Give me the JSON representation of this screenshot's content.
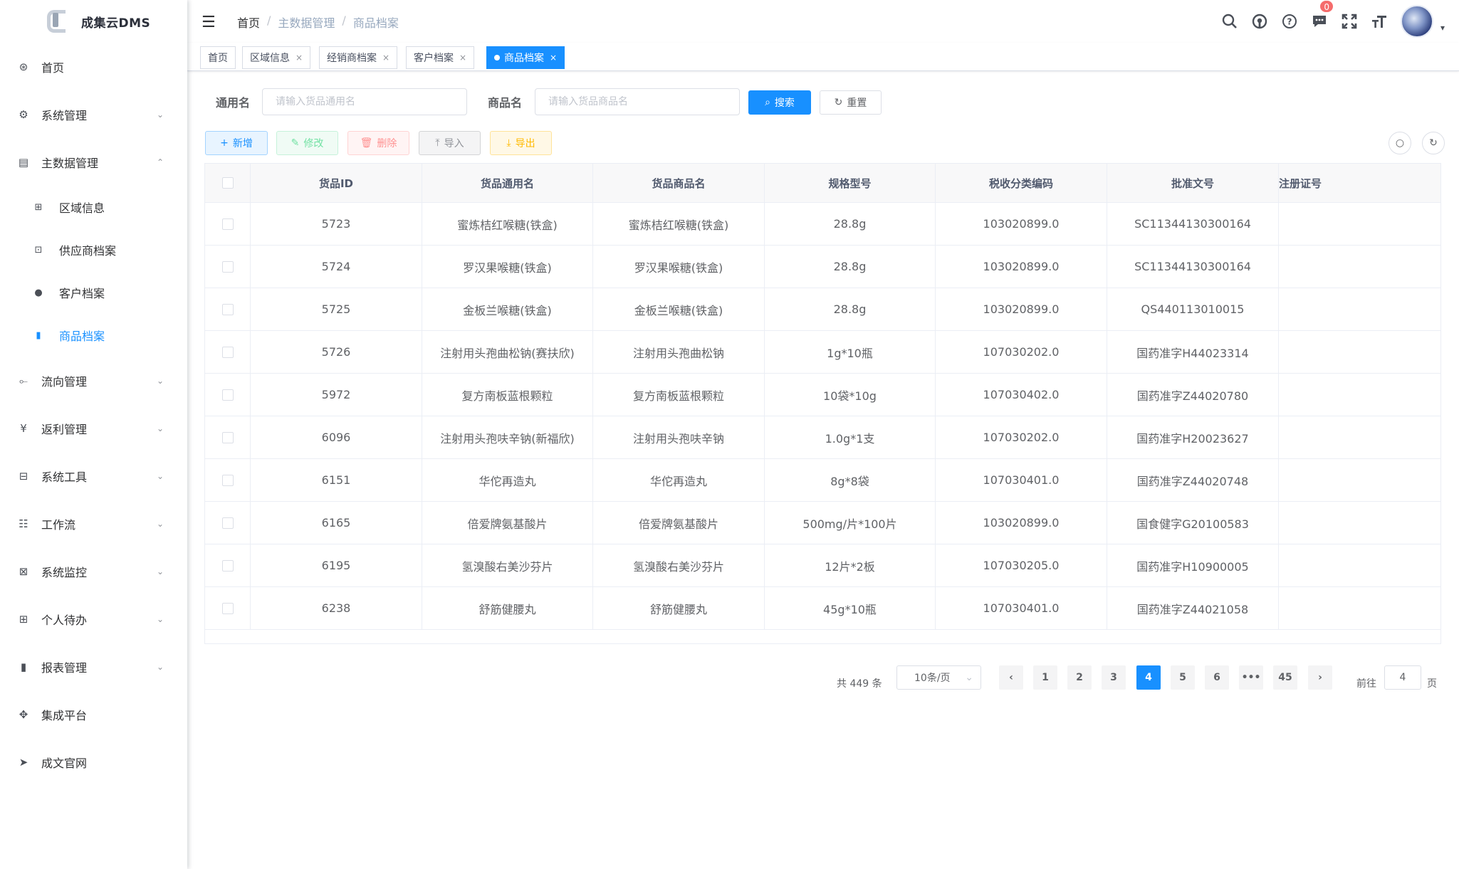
{
  "app": {
    "title": "成集云DMS"
  },
  "sidebar": {
    "items": [
      {
        "label": "首页",
        "icon": "dashboard-icon",
        "glyph": "⊛",
        "arrow": ""
      },
      {
        "label": "系统管理",
        "icon": "gear-icon",
        "glyph": "⚙",
        "arrow": "⌄"
      },
      {
        "label": "主数据管理",
        "icon": "list-icon",
        "glyph": "▤",
        "arrow": "⌃"
      },
      {
        "label": "流向管理",
        "icon": "flow-icon",
        "glyph": "⟜",
        "arrow": "⌄"
      },
      {
        "label": "返利管理",
        "icon": "yen-icon",
        "glyph": "¥",
        "arrow": "⌄"
      },
      {
        "label": "系统工具",
        "icon": "toolbox-icon",
        "glyph": "⊟",
        "arrow": "⌄"
      },
      {
        "label": "工作流",
        "icon": "workflow-icon",
        "glyph": "☷",
        "arrow": "⌄"
      },
      {
        "label": "系统监控",
        "icon": "monitor-icon",
        "glyph": "⊠",
        "arrow": "⌄"
      },
      {
        "label": "个人待办",
        "icon": "grid-icon",
        "glyph": "⊞",
        "arrow": "⌄"
      },
      {
        "label": "报表管理",
        "icon": "bar-chart-icon",
        "glyph": "▮",
        "arrow": "⌄"
      },
      {
        "label": "集成平台",
        "icon": "move-icon",
        "glyph": "✥",
        "arrow": ""
      },
      {
        "label": "成文官网",
        "icon": "send-icon",
        "glyph": "➤",
        "arrow": ""
      }
    ],
    "sub_items": [
      {
        "label": "区域信息",
        "icon": "table-icon",
        "glyph": "⊞"
      },
      {
        "label": "供应商档案",
        "icon": "image-icon",
        "glyph": "⊡"
      },
      {
        "label": "客户档案",
        "icon": "user-icon",
        "glyph": "●"
      },
      {
        "label": "商品档案",
        "icon": "product-icon",
        "glyph": "▮"
      }
    ]
  },
  "breadcrumb": {
    "home": "首页",
    "parent": "主数据管理",
    "current": "商品档案"
  },
  "header": {
    "notifications_count": "0"
  },
  "tags": [
    {
      "label": "首页",
      "closable": false,
      "active": false
    },
    {
      "label": "区域信息",
      "closable": true,
      "active": false
    },
    {
      "label": "经销商档案",
      "closable": true,
      "active": false
    },
    {
      "label": "客户档案",
      "closable": true,
      "active": false
    },
    {
      "label": "商品档案",
      "closable": true,
      "active": true
    }
  ],
  "tag_close": "×",
  "search": {
    "generic_label": "通用名",
    "generic_placeholder": "请输入货品通用名",
    "product_label": "商品名",
    "product_placeholder": "请输入货品商品名",
    "search_button": "搜索",
    "reset_button": "重置"
  },
  "toolbar": {
    "add": "新增",
    "edit": "修改",
    "delete": "删除",
    "import": "导入",
    "export": "导出"
  },
  "table": {
    "columns": [
      "货品ID",
      "货品通用名",
      "货品商品名",
      "规格型号",
      "税收分类编码",
      "批准文号",
      "注册证号"
    ],
    "rows": [
      [
        "5723",
        "蜜炼桔红喉糖(铁盒)",
        "蜜炼桔红喉糖(铁盒)",
        "28.8g",
        "103020899.0",
        "SC11344130300164",
        ""
      ],
      [
        "5724",
        "罗汉果喉糖(铁盒)",
        "罗汉果喉糖(铁盒)",
        "28.8g",
        "103020899.0",
        "SC11344130300164",
        ""
      ],
      [
        "5725",
        "金板兰喉糖(铁盒)",
        "金板兰喉糖(铁盒)",
        "28.8g",
        "103020899.0",
        "QS440113010015",
        ""
      ],
      [
        "5726",
        "注射用头孢曲松钠(赛扶欣)",
        "注射用头孢曲松钠",
        "1g*10瓶",
        "107030202.0",
        "国药准字H44023314",
        ""
      ],
      [
        "5972",
        "复方南板蓝根颗粒",
        "复方南板蓝根颗粒",
        "10袋*10g",
        "107030402.0",
        "国药准字Z44020780",
        ""
      ],
      [
        "6096",
        "注射用头孢呋辛钠(新福欣)",
        "注射用头孢呋辛钠",
        "1.0g*1支",
        "107030202.0",
        "国药准字H20023627",
        ""
      ],
      [
        "6151",
        "华佗再造丸",
        "华佗再造丸",
        "8g*8袋",
        "107030401.0",
        "国药准字Z44020748",
        ""
      ],
      [
        "6165",
        "倍爱牌氨基酸片",
        "倍爱牌氨基酸片",
        "500mg/片*100片",
        "103020899.0",
        "国食健字G20100583",
        ""
      ],
      [
        "6195",
        "氢溴酸右美沙芬片",
        "氢溴酸右美沙芬片",
        "12片*2板",
        "107030205.0",
        "国药准字H10900005",
        ""
      ],
      [
        "6238",
        "舒筋健腰丸",
        "舒筋健腰丸",
        "45g*10瓶",
        "107030401.0",
        "国药准字Z44021058",
        ""
      ]
    ]
  },
  "pagination": {
    "total_text": "共 449 条",
    "page_size": "10条/页",
    "prev": "‹",
    "next": "›",
    "pages": [
      "1",
      "2",
      "3",
      "4",
      "5",
      "6",
      "•••",
      "45"
    ],
    "current": "4",
    "goto_label": "前往",
    "goto_value": "4",
    "goto_suffix": "页"
  }
}
